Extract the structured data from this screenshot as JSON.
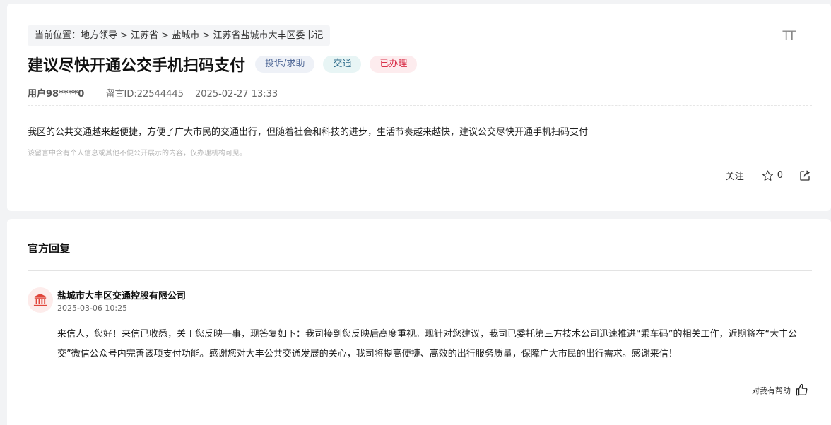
{
  "breadcrumb": {
    "text": "当前位置：地方领导 > 江苏省 > 盐城市 > 江苏省盐城市大丰区委书记"
  },
  "font_toggle": "TT",
  "message": {
    "title": "建议尽快开通公交手机扫码支付",
    "tags": {
      "type": "投诉/求助",
      "domain": "交通",
      "status": "已办理"
    },
    "user": "用户98****0",
    "message_id": "留言ID:22544445",
    "datetime": "2025-02-27 13:33",
    "content": "我区的公共交通越来越便捷，方便了广大市民的交通出行，但随着社会和科技的进步，生活节奏越来越快，建议公交尽快开通手机扫码支付",
    "privacy_notice": "该留言中含有个人信息或其他不便公开展示的内容，仅办理机构可见。"
  },
  "actions": {
    "follow_label": "关注",
    "star_count": "0"
  },
  "reply": {
    "section_title": "官方回复",
    "org_name": "盐城市大丰区交通控股有限公司",
    "time": "2025-03-06 10:25",
    "text": "来信人，您好！来信已收悉，关于您反映一事，现答复如下：我司接到您反映后高度重视。现针对您建议，我司已委托第三方技术公司迅速推进“乘车码”的相关工作，近期将在“大丰公交”微信公众号内完善该项支付功能。感谢您对大丰公共交通发展的关心，我司将提高便捷、高效的出行服务质量，保障广大市民的出行需求。感谢来信！",
    "helpful_label": "对我有帮助"
  },
  "icons": {
    "font_size": "font-size-icon",
    "star": "star-icon",
    "share": "share-icon",
    "org": "government-building-icon",
    "thumb": "thumbs-up-icon"
  },
  "colors": {
    "status_red": "#d9314a",
    "type_tag_text": "#536b99",
    "domain_tag_text": "#2d6b8a",
    "org_icon_red": "#e0453a"
  }
}
